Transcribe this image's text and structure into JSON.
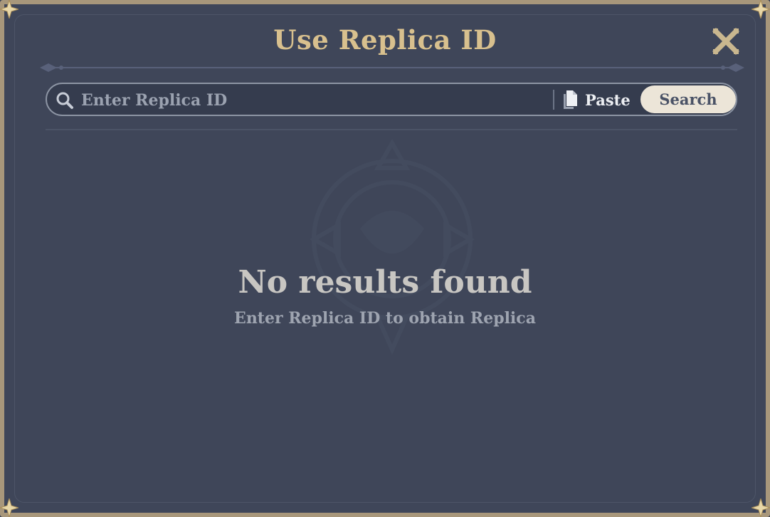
{
  "dialog": {
    "title": "Use Replica ID",
    "close_icon": "close-icon"
  },
  "search": {
    "placeholder": "Enter Replica ID",
    "value": "",
    "search_icon": "search-icon",
    "paste_icon": "paste-icon",
    "paste_label": "Paste",
    "search_label": "Search"
  },
  "empty_state": {
    "title": "No results found",
    "subtitle": "Enter Replica ID to obtain Replica",
    "watermark_icon": "emblem-icon"
  },
  "colors": {
    "background": "#3f4659",
    "title": "#d8c08e",
    "border": "#a8977b",
    "search_button": "#ece5d8"
  }
}
